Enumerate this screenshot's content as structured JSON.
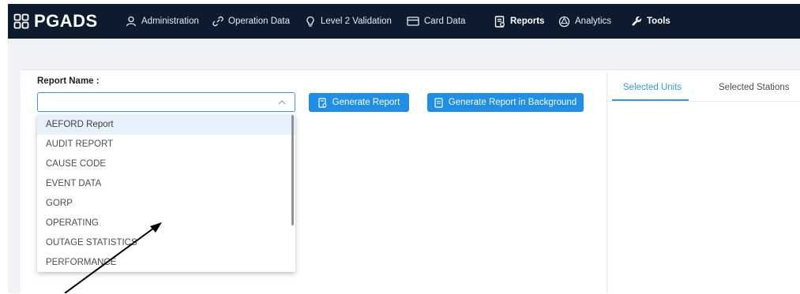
{
  "app": {
    "brand": "PGADS"
  },
  "nav": [
    {
      "label": "Administration",
      "icon": "user-icon"
    },
    {
      "label": "Operation Data",
      "icon": "link-icon"
    },
    {
      "label": "Level 2 Validation",
      "icon": "lightbulb-icon"
    },
    {
      "label": "Card Data",
      "icon": "card-icon"
    },
    {
      "label": "Reports",
      "icon": "report-icon"
    },
    {
      "label": "Analytics",
      "icon": "analytics-icon"
    },
    {
      "label": "Tools",
      "icon": "wrench-icon"
    }
  ],
  "form": {
    "report_name_label": "Report Name :",
    "select_value": "",
    "generate_button": "Generate Report",
    "generate_bg_button": "Generate Report in Background"
  },
  "dropdown_options": [
    "AEFORD Report",
    "AUDIT REPORT",
    "CAUSE CODE",
    "EVENT DATA",
    "GORP",
    "OPERATING",
    "OUTAGE STATISTICS",
    "PERFORMANCE"
  ],
  "tabs": {
    "selected_units": "Selected Units",
    "selected_stations": "Selected Stations"
  },
  "colors": {
    "topbar": "#0d1b2e",
    "accent": "#1f8ee6",
    "highlight": "#e8f1fb"
  }
}
